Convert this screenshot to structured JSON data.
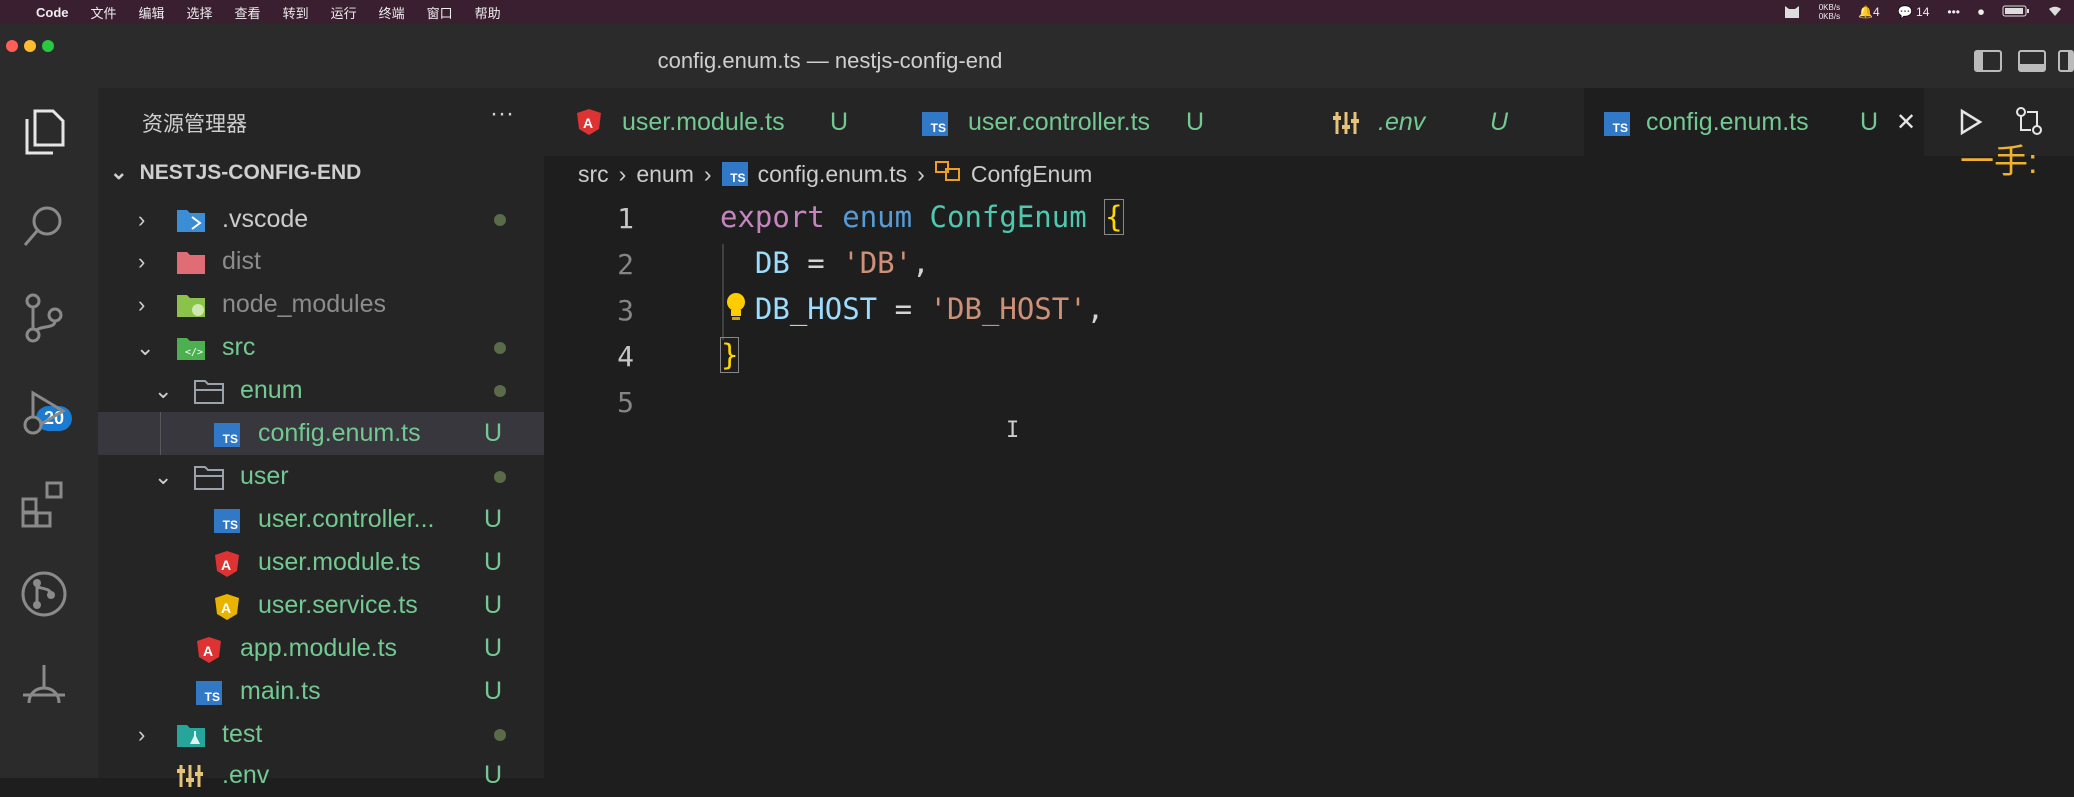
{
  "menubar": {
    "items": [
      "Code",
      "文件",
      "编辑",
      "选择",
      "查看",
      "转到",
      "运行",
      "终端",
      "窗口",
      "帮助"
    ],
    "net_up": "0KB/s",
    "net_down": "0KB/s",
    "notif_count": "4",
    "wechat_count": "14"
  },
  "window": {
    "title": "config.enum.ts — nestjs-config-end"
  },
  "activity": {
    "scm_badge": "20"
  },
  "sidebar": {
    "title": "资源管理器",
    "more": "···",
    "root": "NESTJS-CONFIG-END",
    "rows": [
      {
        "name": ".vscode",
        "status": ""
      },
      {
        "name": "dist",
        "status": ""
      },
      {
        "name": "node_modules",
        "status": ""
      },
      {
        "name": "src",
        "status": ""
      },
      {
        "name": "enum",
        "status": ""
      },
      {
        "name": "config.enum.ts",
        "status": "U"
      },
      {
        "name": "user",
        "status": ""
      },
      {
        "name": "user.controller...",
        "status": "U"
      },
      {
        "name": "user.module.ts",
        "status": "U"
      },
      {
        "name": "user.service.ts",
        "status": "U"
      },
      {
        "name": "app.module.ts",
        "status": "U"
      },
      {
        "name": "main.ts",
        "status": "U"
      },
      {
        "name": "test",
        "status": ""
      },
      {
        "name": ".env",
        "status": "U"
      }
    ]
  },
  "tabs": [
    {
      "label": "user.module.ts",
      "status": "U"
    },
    {
      "label": "user.controller.ts",
      "status": "U"
    },
    {
      "label": ".env",
      "status": "U"
    },
    {
      "label": "config.enum.ts",
      "status": "U",
      "close": "✕"
    }
  ],
  "breadcrumb": [
    "src",
    "enum",
    "config.enum.ts",
    "ConfgEnum"
  ],
  "editor": {
    "line_numbers": [
      "1",
      "2",
      "3",
      "4",
      "5"
    ],
    "line1": {
      "kw": "export",
      "kw2": "enum",
      "name": "ConfgEnum",
      "brace": "{"
    },
    "line2": {
      "prop": "DB",
      "eq": " = ",
      "str": "'DB'",
      "comma": ","
    },
    "line3": {
      "prop": "DB_HOST",
      "eq": " = ",
      "str": "'DB_HOST'",
      "comma": ","
    },
    "line4": {
      "brace": "}"
    }
  },
  "overlay_text": "一手:"
}
